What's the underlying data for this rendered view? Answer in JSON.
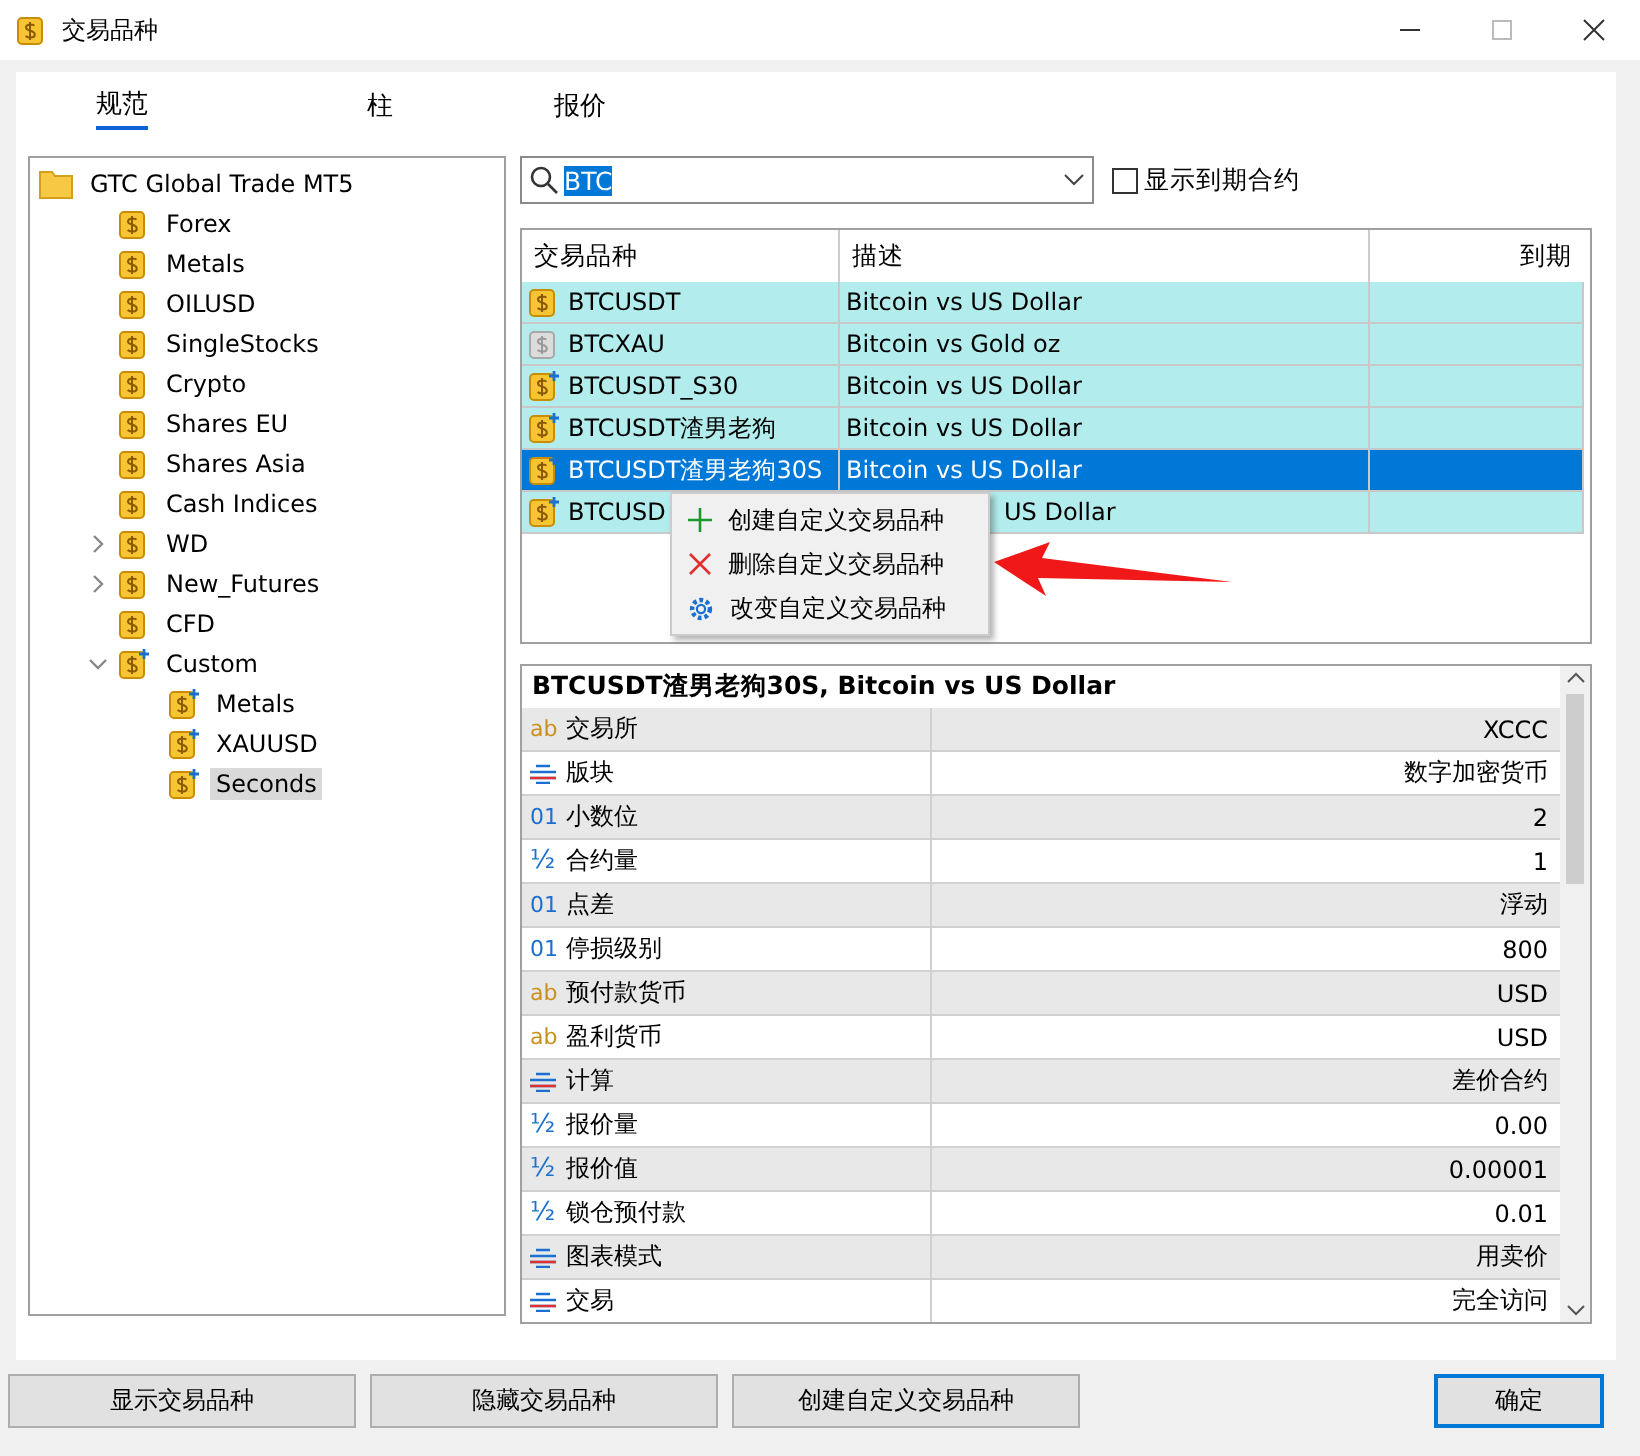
{
  "window": {
    "title": "交易品种"
  },
  "tabs": [
    {
      "label": "规范",
      "selected": true
    },
    {
      "label": "柱",
      "selected": false
    },
    {
      "label": "报价",
      "selected": false
    }
  ],
  "tree": {
    "label": "GTC Global Trade MT5",
    "kind": "folder",
    "selected": false,
    "children": [
      {
        "label": "Forex",
        "kind": "symbol",
        "selected": false
      },
      {
        "label": "Metals",
        "kind": "symbol",
        "selected": false
      },
      {
        "label": "OILUSD",
        "kind": "symbol",
        "selected": false
      },
      {
        "label": "SingleStocks",
        "kind": "symbol",
        "selected": false
      },
      {
        "label": "Crypto",
        "kind": "symbol",
        "selected": false
      },
      {
        "label": "Shares EU",
        "kind": "symbol",
        "selected": false
      },
      {
        "label": "Shares Asia",
        "kind": "symbol",
        "selected": false
      },
      {
        "label": "Cash Indices",
        "kind": "symbol",
        "selected": false
      },
      {
        "label": "WD",
        "kind": "symbol",
        "selected": false,
        "expanded": false
      },
      {
        "label": "New_Futures",
        "kind": "symbol",
        "selected": false,
        "expanded": false
      },
      {
        "label": "CFD",
        "kind": "symbol",
        "selected": false
      },
      {
        "label": "Custom",
        "kind": "custom",
        "selected": false,
        "expanded": true,
        "children": [
          {
            "label": "Metals",
            "kind": "custom",
            "selected": false
          },
          {
            "label": "XAUUSD",
            "kind": "custom",
            "selected": false
          },
          {
            "label": "Seconds",
            "kind": "custom",
            "selected": true
          }
        ]
      }
    ]
  },
  "search": {
    "value": "BTC"
  },
  "show_expired": {
    "label": "显示到期合约",
    "checked": false
  },
  "table": {
    "columns": [
      "交易品种",
      "描述",
      "到期"
    ],
    "rows": [
      {
        "kind": "symbol",
        "name": "BTCUSDT",
        "description": "Bitcoin vs US Dollar",
        "selected": false
      },
      {
        "kind": "disabled",
        "name": "BTCXAU",
        "description": "Bitcoin vs Gold oz",
        "selected": false
      },
      {
        "kind": "custom",
        "name": "BTCUSDT_S30",
        "description": "Bitcoin vs US Dollar",
        "selected": false
      },
      {
        "kind": "custom",
        "name": "BTCUSDT渣男老狗",
        "description": "Bitcoin vs US Dollar",
        "selected": false
      },
      {
        "kind": "custom",
        "name": "BTCUSDT渣男老狗30S",
        "description": "Bitcoin vs US Dollar",
        "selected": true
      },
      {
        "kind": "custom",
        "name": "BTCUSD",
        "description": "US Dollar",
        "selected": false
      }
    ]
  },
  "context_menu": [
    {
      "kind": "add",
      "label": "创建自定义交易品种"
    },
    {
      "kind": "delete",
      "label": "删除自定义交易品种"
    },
    {
      "kind": "settings",
      "label": "改变自定义交易品种"
    }
  ],
  "details": {
    "title": "BTCUSDT渣男老狗30S, Bitcoin vs US Dollar",
    "rows": [
      {
        "kind": "text",
        "icon": "ab",
        "name": "交易所",
        "value": "XCCC"
      },
      {
        "kind": "list",
        "name": "版块",
        "value": "数字加密货币"
      },
      {
        "kind": "int",
        "icon": "01",
        "name": "小数位",
        "value": "2"
      },
      {
        "kind": "frac",
        "icon": "½",
        "name": "合约量",
        "value": "1"
      },
      {
        "kind": "int",
        "icon": "01",
        "name": "点差",
        "value": "浮动"
      },
      {
        "kind": "int",
        "icon": "01",
        "name": "停损级别",
        "value": "800"
      },
      {
        "kind": "text",
        "icon": "ab",
        "name": "预付款货币",
        "value": "USD"
      },
      {
        "kind": "text",
        "icon": "ab",
        "name": "盈利货币",
        "value": "USD"
      },
      {
        "kind": "list",
        "name": "计算",
        "value": "差价合约"
      },
      {
        "kind": "frac",
        "icon": "½",
        "name": "报价量",
        "value": "0.00"
      },
      {
        "kind": "frac",
        "icon": "½",
        "name": "报价值",
        "value": "0.00001"
      },
      {
        "kind": "frac",
        "icon": "½",
        "name": "锁仓预付款",
        "value": "0.01"
      },
      {
        "kind": "list",
        "name": "图表模式",
        "value": "用卖价"
      },
      {
        "kind": "list",
        "name": "交易",
        "value": "完全访问"
      }
    ]
  },
  "buttons": [
    {
      "label": "显示交易品种",
      "kind": "normal"
    },
    {
      "label": "隐藏交易品种",
      "kind": "normal"
    },
    {
      "label": "创建自定义交易品种",
      "kind": "normal"
    },
    {
      "label": "确定",
      "kind": "default"
    }
  ]
}
